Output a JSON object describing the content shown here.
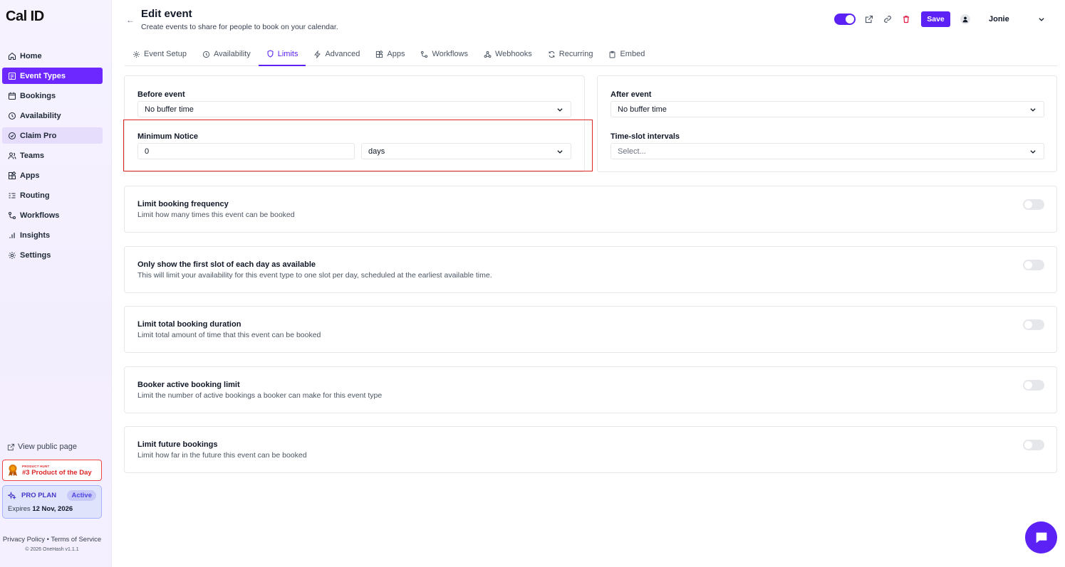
{
  "app": {
    "logo": "Cal ID"
  },
  "sidebar": {
    "items": [
      {
        "label": "Home",
        "icon": "home-icon"
      },
      {
        "label": "Event Types",
        "icon": "event-types-icon",
        "active": true
      },
      {
        "label": "Bookings",
        "icon": "calendar-icon"
      },
      {
        "label": "Availability",
        "icon": "clock-icon"
      },
      {
        "label": "Claim Pro",
        "icon": "badge-icon"
      },
      {
        "label": "Teams",
        "icon": "users-icon"
      },
      {
        "label": "Apps",
        "icon": "apps-icon"
      },
      {
        "label": "Routing",
        "icon": "routing-icon"
      },
      {
        "label": "Workflows",
        "icon": "workflow-icon"
      },
      {
        "label": "Insights",
        "icon": "insights-icon"
      },
      {
        "label": "Settings",
        "icon": "gear-icon"
      }
    ],
    "view_public": "View public page",
    "product_hunt": {
      "small": "PRODUCT HUNT",
      "big": "#3 Product of the Day"
    },
    "plan": {
      "name": "PRO PLAN",
      "status": "Active",
      "expires_label": "Expires",
      "expires_date": "12 Nov, 2026"
    },
    "footer": {
      "privacy": "Privacy Policy",
      "sep": "•",
      "terms": "Terms of Service",
      "copyright": "© 2026 OneHash v1.1.1"
    }
  },
  "header": {
    "back": "←",
    "title": "Edit event",
    "subtitle": "Create events to share for people to book on your calendar.",
    "save_label": "Save",
    "username": "Jonie"
  },
  "tabs": [
    {
      "label": "Event Setup",
      "icon": "gear-icon"
    },
    {
      "label": "Availability",
      "icon": "clock-icon"
    },
    {
      "label": "Limits",
      "icon": "shield-icon",
      "active": true
    },
    {
      "label": "Advanced",
      "icon": "bolt-icon"
    },
    {
      "label": "Apps",
      "icon": "apps-icon"
    },
    {
      "label": "Workflows",
      "icon": "workflow-icon"
    },
    {
      "label": "Webhooks",
      "icon": "webhook-icon"
    },
    {
      "label": "Recurring",
      "icon": "repeat-icon"
    },
    {
      "label": "Embed",
      "icon": "clipboard-icon"
    }
  ],
  "limits": {
    "before_event": {
      "label": "Before event",
      "value": "No buffer time"
    },
    "after_event": {
      "label": "After event",
      "value": "No buffer time"
    },
    "minimum_notice": {
      "label": "Minimum Notice",
      "value": "0",
      "unit": "days"
    },
    "time_slot": {
      "label": "Time-slot intervals",
      "placeholder": "Select..."
    }
  },
  "toggles": [
    {
      "title": "Limit booking frequency",
      "desc": "Limit how many times this event can be booked",
      "on": false
    },
    {
      "title": "Only show the first slot of each day as available",
      "desc": "This will limit your availability for this event type to one slot per day, scheduled at the earliest available time.",
      "on": false
    },
    {
      "title": "Limit total booking duration",
      "desc": "Limit total amount of time that this event can be booked",
      "on": false
    },
    {
      "title": "Booker active booking limit",
      "desc": "Limit the number of active bookings a booker can make for this event type",
      "on": false
    },
    {
      "title": "Limit future bookings",
      "desc": "Limit how far in the future this event can be booked",
      "on": false
    }
  ],
  "colors": {
    "accent": "#5b21f5",
    "highlight": "#dc2626"
  }
}
